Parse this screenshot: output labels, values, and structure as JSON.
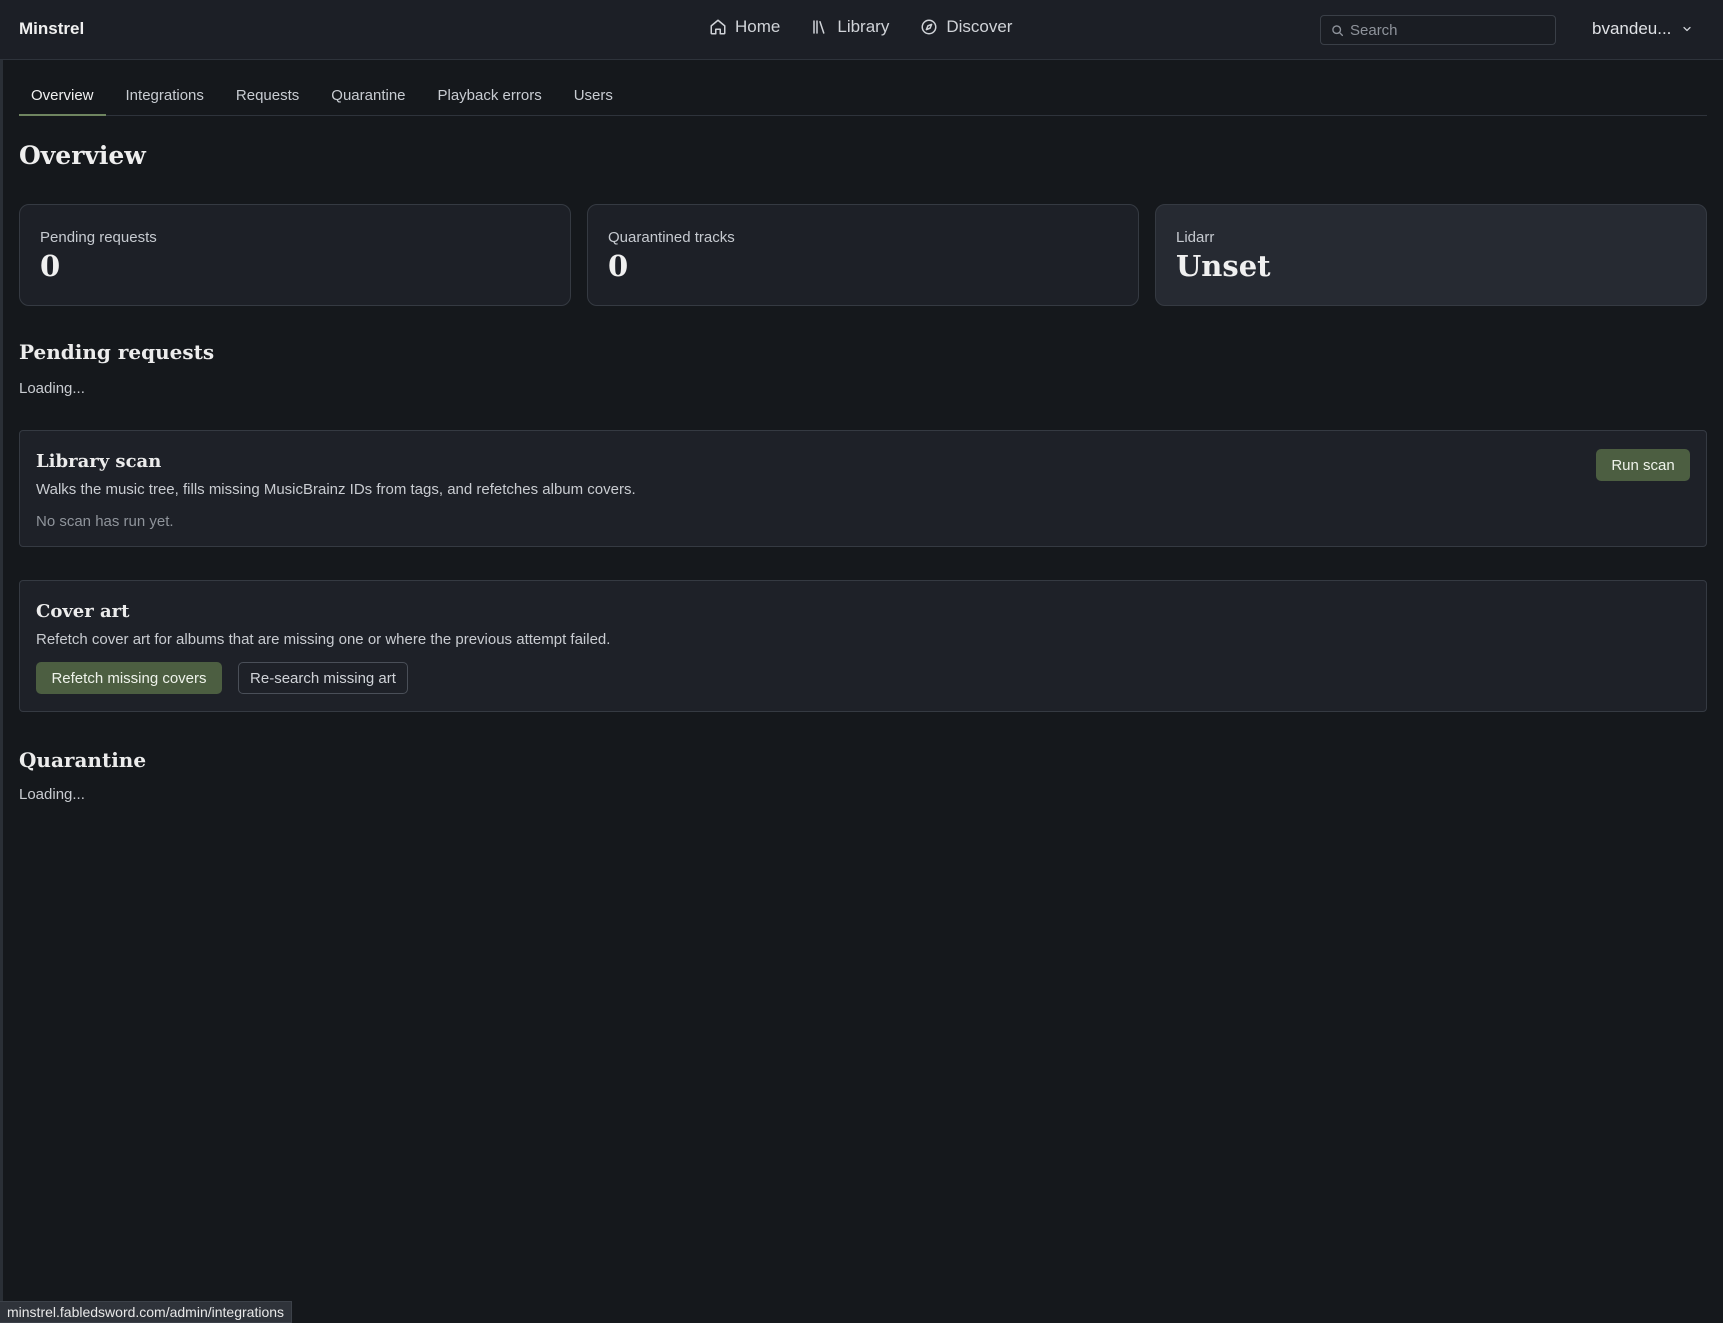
{
  "app": {
    "brand": "Minstrel"
  },
  "nav": {
    "links": [
      {
        "label": "Home",
        "icon": "home-icon"
      },
      {
        "label": "Library",
        "icon": "library-icon"
      },
      {
        "label": "Discover",
        "icon": "compass-icon"
      }
    ],
    "search_placeholder": "Search",
    "user_label": "bvandeu..."
  },
  "tabs": [
    {
      "label": "Overview",
      "active": true
    },
    {
      "label": "Integrations",
      "active": false
    },
    {
      "label": "Requests",
      "active": false
    },
    {
      "label": "Quarantine",
      "active": false
    },
    {
      "label": "Playback errors",
      "active": false
    },
    {
      "label": "Users",
      "active": false
    }
  ],
  "page_title": "Overview",
  "stats": [
    {
      "label": "Pending requests",
      "value": "0"
    },
    {
      "label": "Quarantined tracks",
      "value": "0"
    },
    {
      "label": "Lidarr",
      "value": "Unset"
    }
  ],
  "pending_requests": {
    "title": "Pending requests",
    "status": "Loading..."
  },
  "library_scan": {
    "title": "Library scan",
    "description": "Walks the music tree, fills missing MusicBrainz IDs from tags, and refetches album covers.",
    "status": "No scan has run yet.",
    "button": "Run scan"
  },
  "cover_art": {
    "title": "Cover art",
    "description": "Refetch cover art for albums that are missing one or where the previous attempt failed.",
    "primary_button": "Refetch missing covers",
    "secondary_button": "Re-search missing art"
  },
  "quarantine": {
    "title": "Quarantine",
    "status": "Loading..."
  },
  "statusbar": {
    "url": "minstrel.fabledsword.com/admin/integrations"
  },
  "colors": {
    "accent": "#4c5e41",
    "background": "#15181c",
    "panel": "#1e2128"
  }
}
